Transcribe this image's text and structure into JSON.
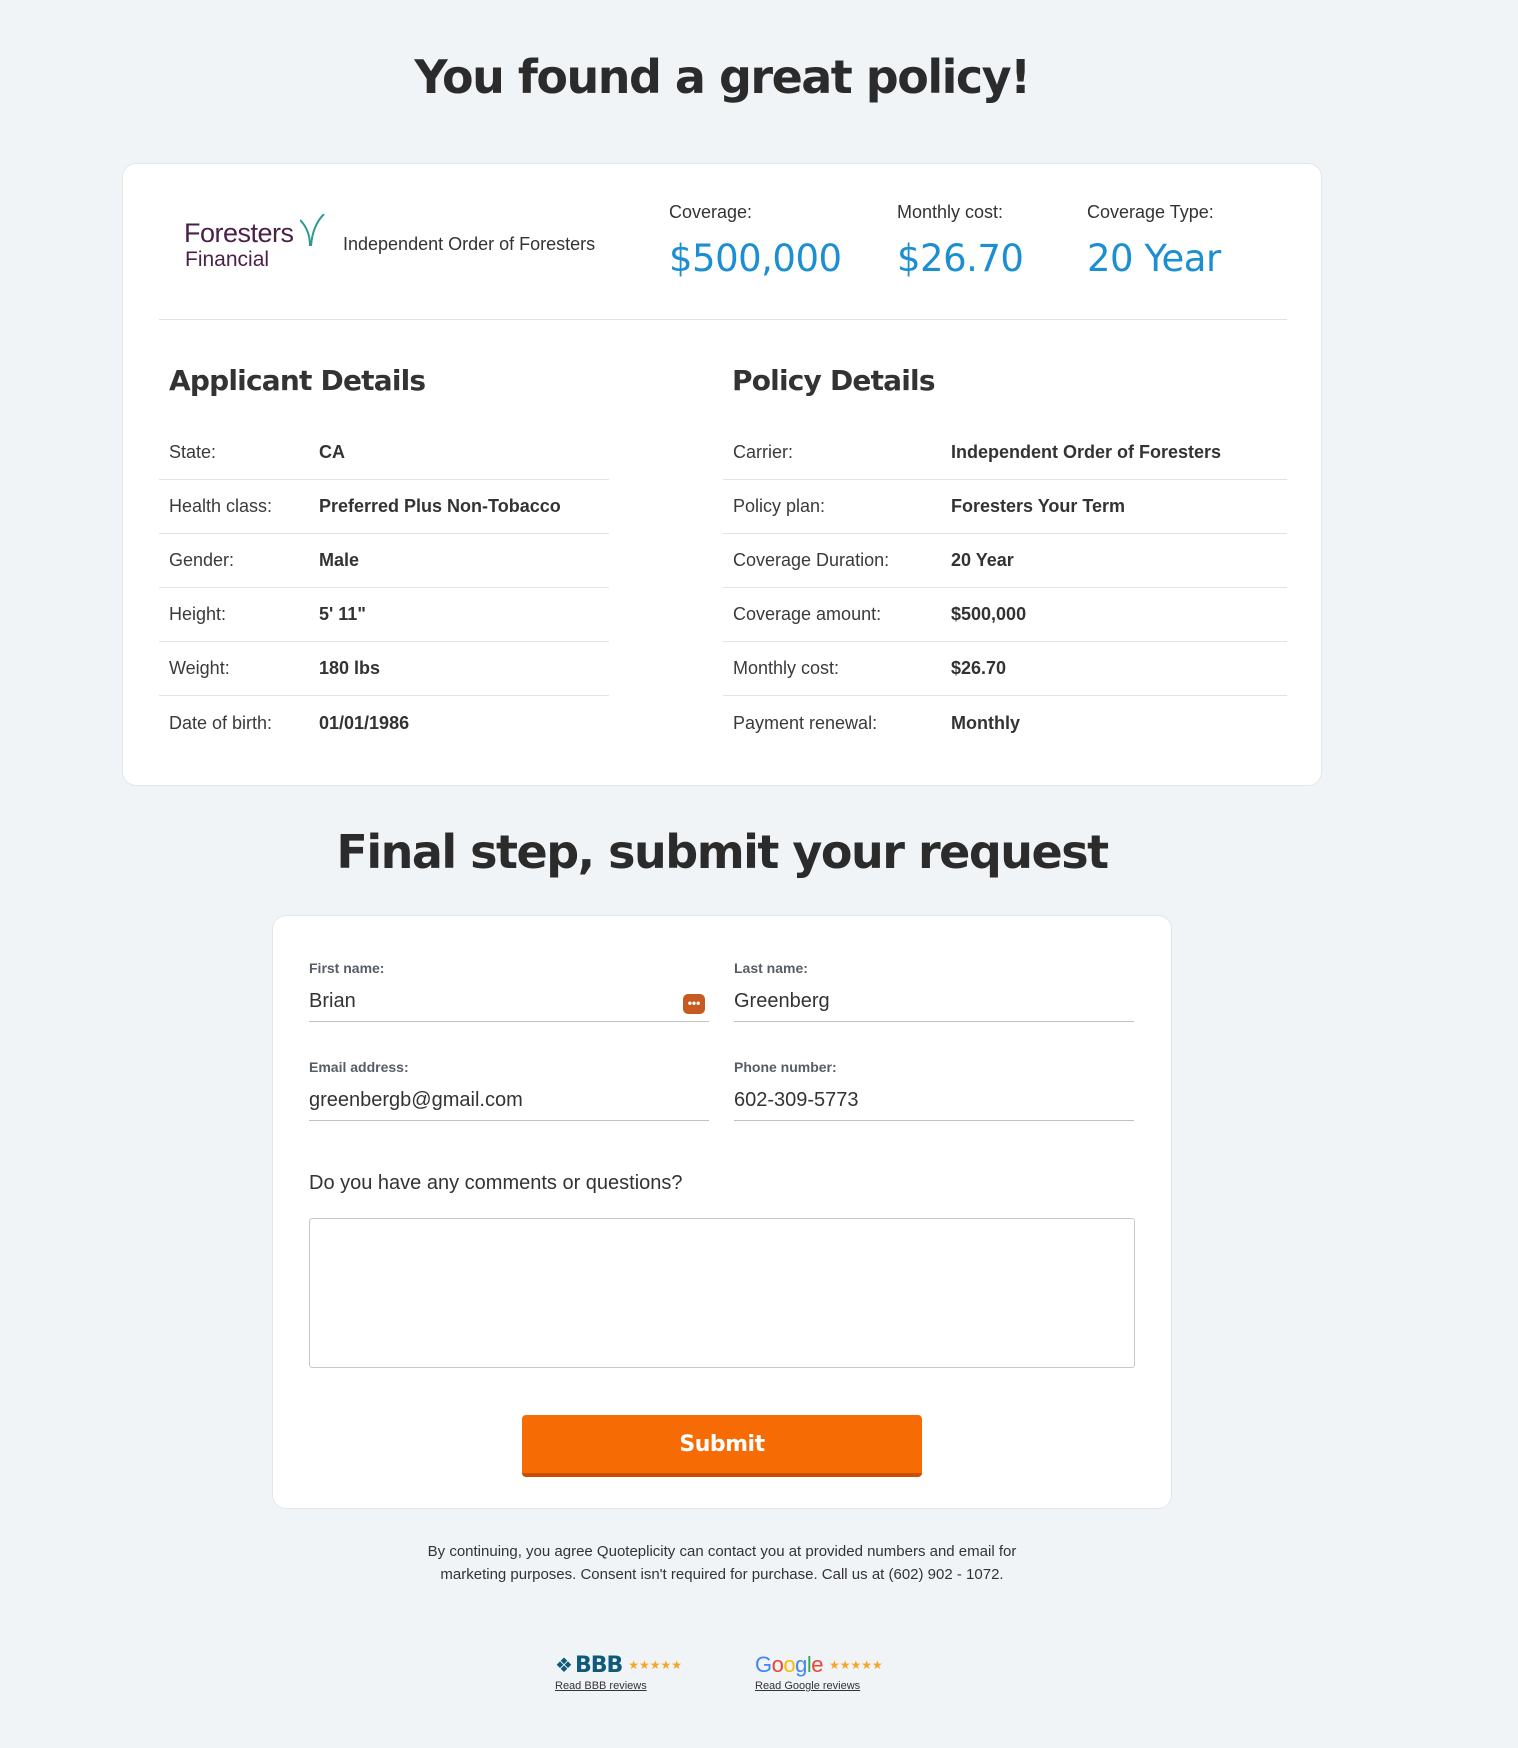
{
  "headings": {
    "title": "You found a great policy!",
    "final_step": "Final step, submit your request"
  },
  "logo": {
    "word1": "Foresters",
    "word2": "Financial",
    "brand_color": "#4a1f48",
    "leaf_color": "#2e9a8f"
  },
  "summary": {
    "carrier_name": "Independent Order of Foresters",
    "coverage_label": "Coverage:",
    "coverage_value": "$500,000",
    "monthly_label": "Monthly cost:",
    "monthly_value": "$26.70",
    "type_label": "Coverage Type:",
    "type_value": "20 Year",
    "accent_color": "#1c8ed2"
  },
  "applicant": {
    "title": "Applicant Details",
    "rows": [
      {
        "label": "State:",
        "value": "CA"
      },
      {
        "label": "Health class:",
        "value": "Preferred Plus Non-Tobacco"
      },
      {
        "label": "Gender:",
        "value": "Male"
      },
      {
        "label": "Height:",
        "value": "5' 11\""
      },
      {
        "label": "Weight:",
        "value": "180 lbs"
      },
      {
        "label": "Date of birth:",
        "value": "01/01/1986"
      }
    ]
  },
  "policy": {
    "title": "Policy Details",
    "rows": [
      {
        "label": "Carrier:",
        "value": "Independent Order of Foresters"
      },
      {
        "label": "Policy plan:",
        "value": "Foresters Your Term"
      },
      {
        "label": "Coverage Duration:",
        "value": "20 Year"
      },
      {
        "label": "Coverage amount:",
        "value": "$500,000"
      },
      {
        "label": "Monthly cost:",
        "value": "$26.70"
      },
      {
        "label": "Payment renewal:",
        "value": "Monthly"
      }
    ]
  },
  "form": {
    "first_name_label": "First name:",
    "first_name_value": "Brian",
    "password_manager_icon_text": "•••",
    "last_name_label": "Last name:",
    "last_name_value": "Greenberg",
    "email_label": "Email address:",
    "email_value": "greenbergb@gmail.com",
    "phone_label": "Phone number:",
    "phone_value": "602-309-5773",
    "comments_label": "Do you have any comments or questions?",
    "comments_value": "",
    "submit_label": "Submit",
    "submit_color": "#f76b05"
  },
  "consent_text": "By continuing, you agree Quoteplicity can contact you at provided numbers and email for marketing purposes. Consent isn't required for purchase. Call us at (602) 902 - 1072.",
  "reviews": {
    "bbb_logo": "BBB",
    "bbb_stars": "★★★★★",
    "bbb_link": "Read BBB reviews",
    "google_letters": [
      "G",
      "o",
      "o",
      "g",
      "l",
      "e"
    ],
    "google_stars": "★★★★★",
    "google_link": "Read Google reviews"
  }
}
